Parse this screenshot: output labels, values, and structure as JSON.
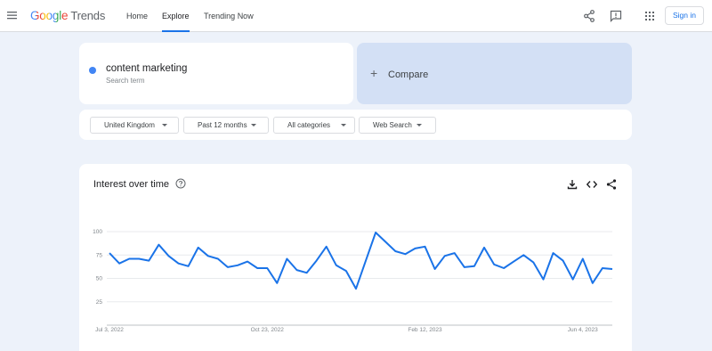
{
  "header": {
    "logo_google": "Google",
    "logo_product": "Trends",
    "nav": [
      "Home",
      "Explore",
      "Trending Now"
    ],
    "signin_label": "Sign in"
  },
  "search": {
    "term": "content marketing",
    "subtitle": "Search term",
    "compare_label": "Compare"
  },
  "filters": {
    "region": "United Kingdom",
    "period": "Past 12 months",
    "category": "All categories",
    "property": "Web Search"
  },
  "chart": {
    "title": "Interest over time"
  },
  "chart_data": {
    "type": "line",
    "title": "Interest over time",
    "xlabel": "",
    "ylabel": "",
    "ylim": [
      0,
      100
    ],
    "y_ticks": [
      25,
      50,
      75,
      100
    ],
    "x_tick_labels": [
      "Jul 3, 2022",
      "Oct 23, 2022",
      "Feb 12, 2023",
      "Jun 4, 2023"
    ],
    "x_tick_index": [
      0,
      16,
      32,
      48
    ],
    "series": [
      {
        "color": "#1a73e8",
        "values": [
          77,
          66,
          71,
          71,
          69,
          86,
          74,
          66,
          63,
          83,
          74,
          71,
          62,
          64,
          68,
          61,
          61,
          45,
          71,
          59,
          56,
          69,
          84,
          64,
          58,
          39,
          69,
          99,
          89,
          79,
          76,
          82,
          84,
          60,
          74,
          77,
          62,
          63,
          83,
          65,
          61,
          68,
          75,
          67,
          49,
          77,
          69,
          49,
          71,
          45,
          61,
          60
        ]
      }
    ]
  }
}
